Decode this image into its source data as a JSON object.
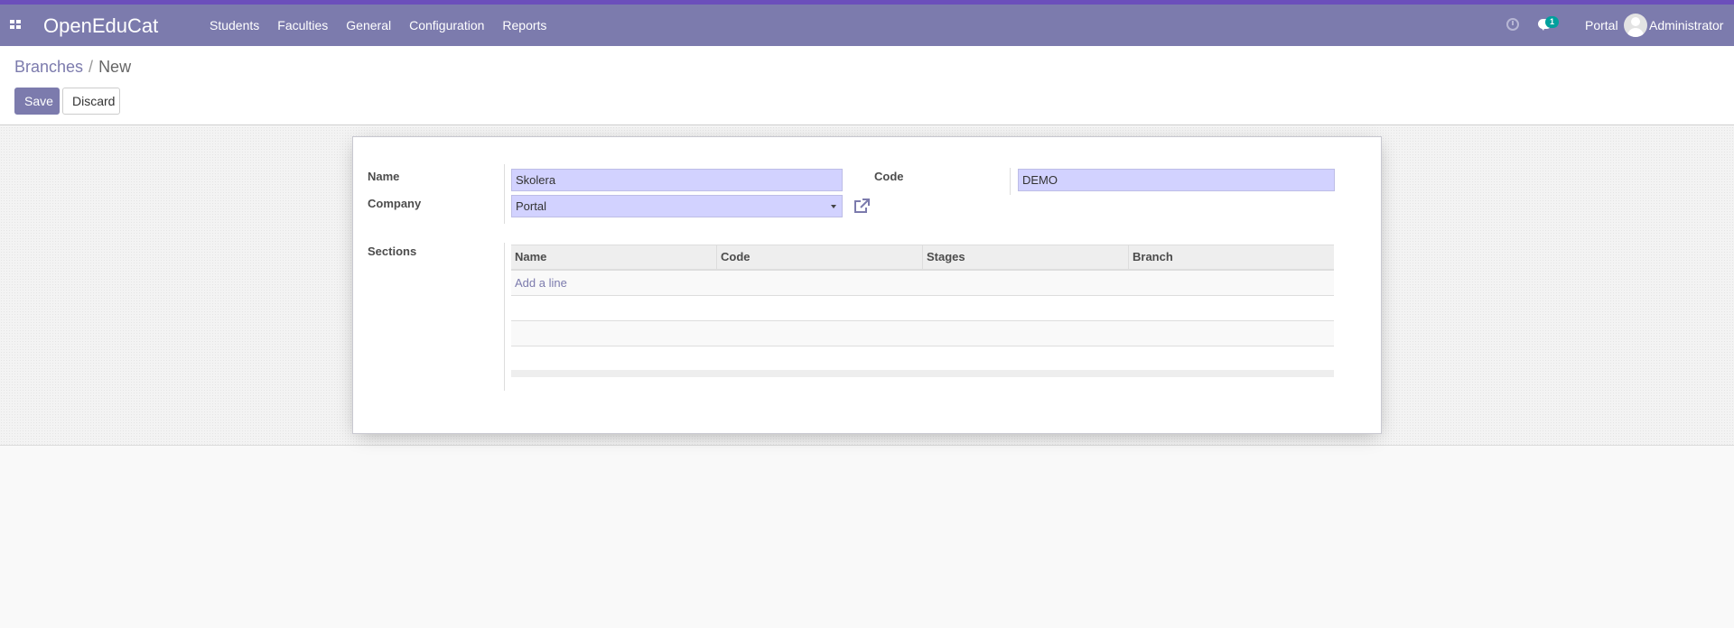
{
  "app": {
    "brand": "OpenEduCat",
    "menu": [
      "Students",
      "Faculties",
      "General",
      "Configuration",
      "Reports"
    ],
    "chat_count": "1",
    "portal_label": "Portal",
    "user_name": "Administrator"
  },
  "breadcrumb": {
    "parent": "Branches",
    "current": "New"
  },
  "buttons": {
    "save": "Save",
    "discard": "Discard"
  },
  "form": {
    "name_label": "Name",
    "name_value": "Skolera",
    "company_label": "Company",
    "company_value": "Portal",
    "code_label": "Code",
    "code_value": "DEMO",
    "sections_label": "Sections"
  },
  "sections_table": {
    "columns": [
      "Name",
      "Code",
      "Stages",
      "Branch"
    ],
    "add_line": "Add a line"
  },
  "colors": {
    "navbar": "#7c7bad",
    "accent": "#6b4fbb",
    "required_field": "#d2d2ff",
    "badge": "#00a09d"
  }
}
